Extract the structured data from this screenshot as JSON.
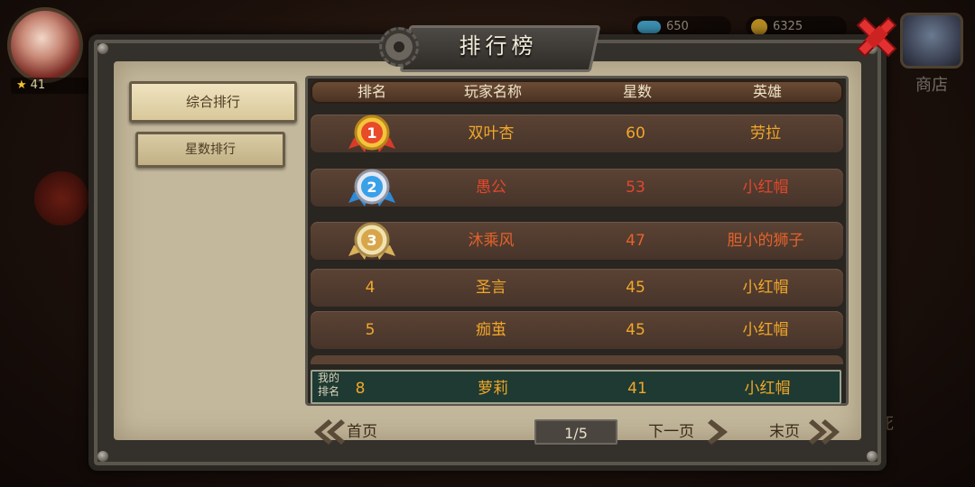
{
  "hud": {
    "level": "41",
    "shop_label": "商店",
    "currency_a": "650",
    "currency_b": "6325",
    "bg_fragment": "死"
  },
  "title": "排行榜",
  "tabs": [
    {
      "label": "综合排行",
      "active": true
    },
    {
      "label": "星数排行",
      "active": false
    }
  ],
  "table": {
    "headers": {
      "rank": "排名",
      "name": "玩家名称",
      "stars": "星数",
      "hero": "英雄"
    },
    "rows": [
      {
        "rank": "1",
        "name": "双叶杏",
        "stars": "60",
        "hero": "劳拉",
        "medal": "gold"
      },
      {
        "rank": "2",
        "name": "愚公",
        "stars": "53",
        "hero": "小红帽",
        "medal": "silver"
      },
      {
        "rank": "3",
        "name": "沐乘风",
        "stars": "47",
        "hero": "胆小的狮子",
        "medal": "bronze"
      },
      {
        "rank": "4",
        "name": "圣言",
        "stars": "45",
        "hero": "小红帽"
      },
      {
        "rank": "5",
        "name": "痂茧",
        "stars": "45",
        "hero": "小红帽"
      }
    ],
    "my_rank": {
      "tag": "我的排名",
      "tag_line1": "我的",
      "tag_line2": "排名",
      "rank": "8",
      "name": "萝莉",
      "stars": "41",
      "hero": "小红帽"
    }
  },
  "pagination": {
    "first": "首页",
    "prev_next": "下一页",
    "last": "末页",
    "indicator": "1/5"
  },
  "colors": {
    "rank1_text": "#f1a72a",
    "rank2_text": "#e0482c",
    "rank3_text": "#e4622b",
    "normal_text": "#f1a72a",
    "my_row_bg": "#1e3a32"
  }
}
